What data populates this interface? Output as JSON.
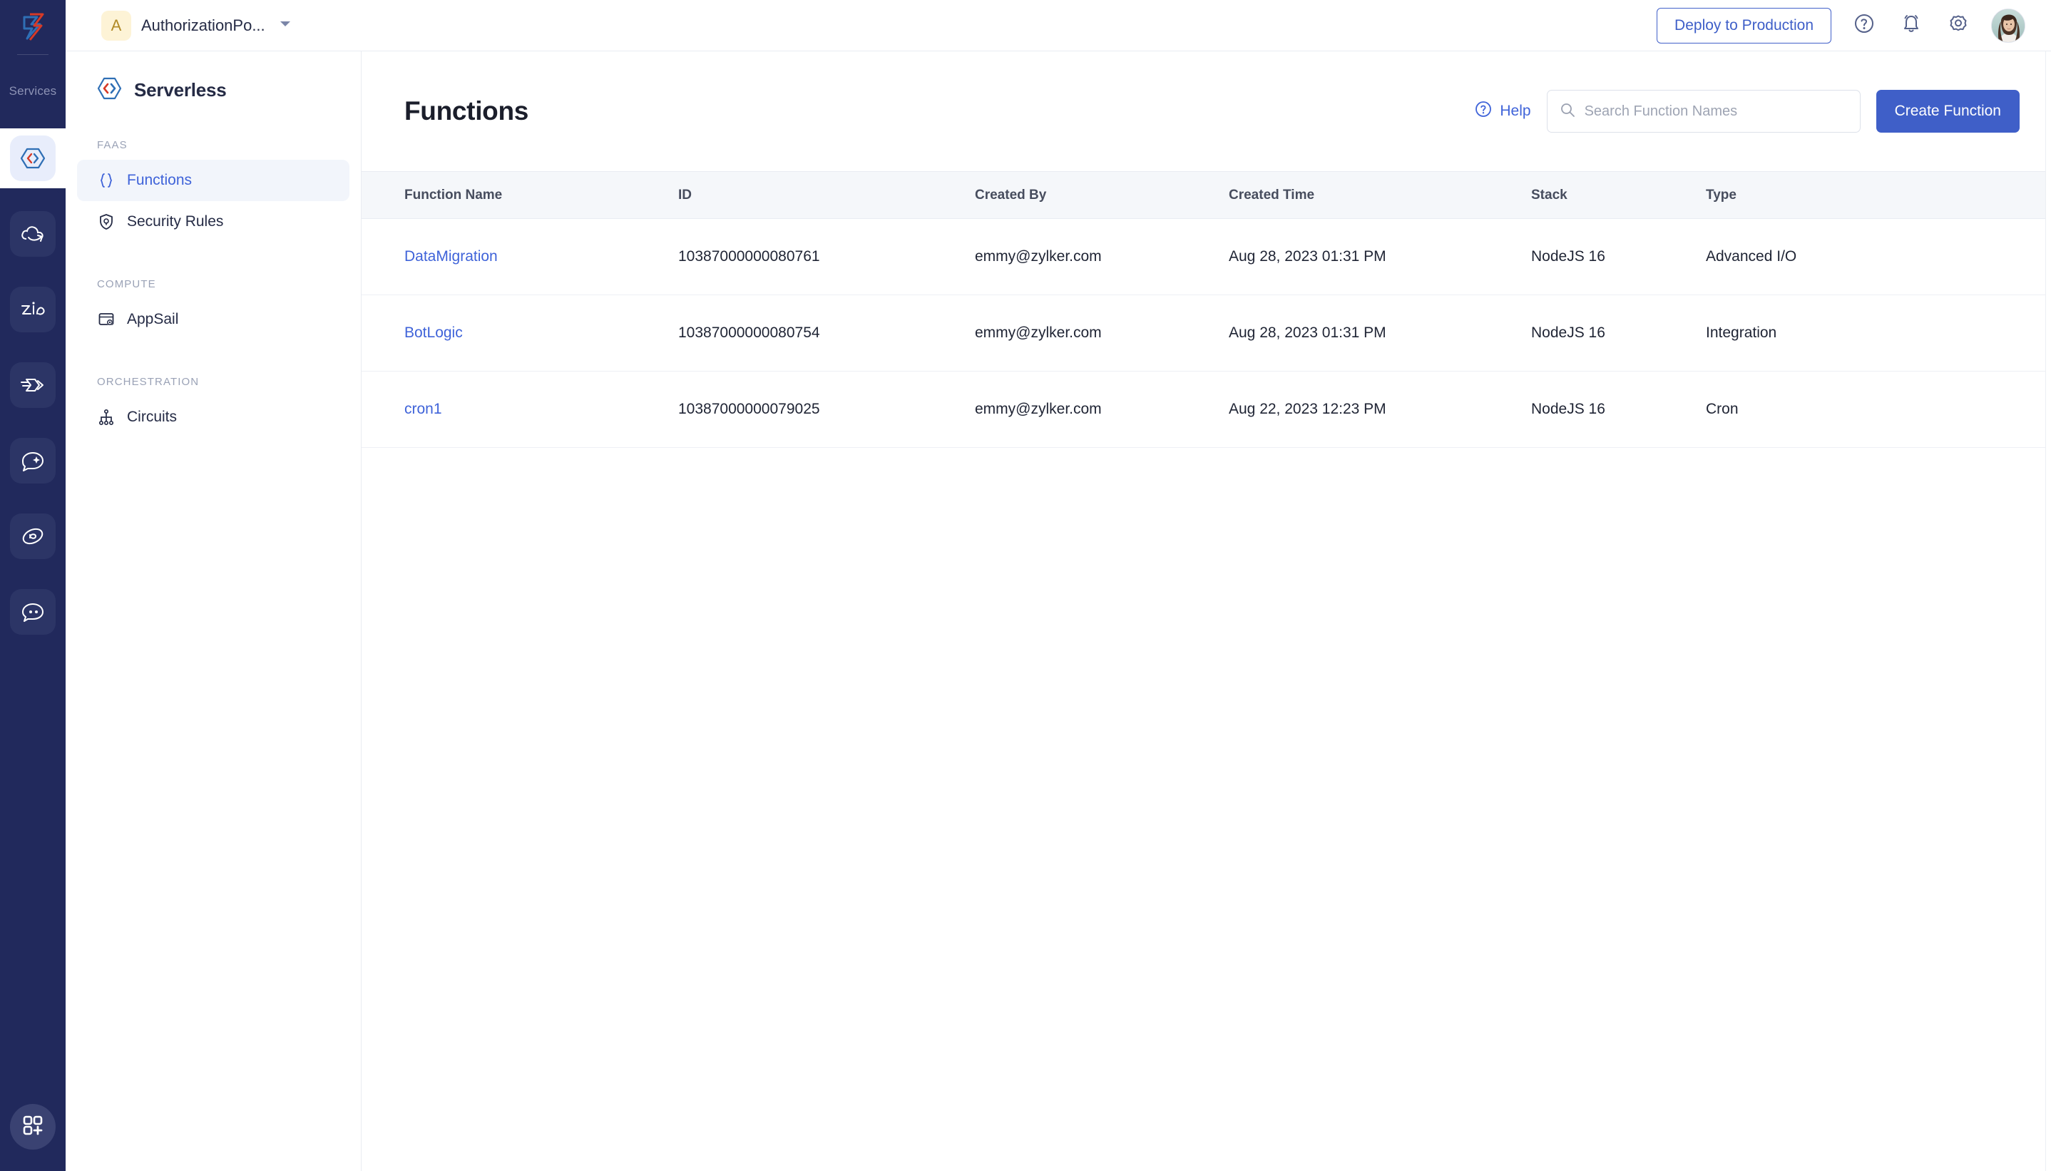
{
  "rail": {
    "logo_name": "zoho-catalyst-logo",
    "services_label": "Services",
    "items": [
      {
        "name": "serverless",
        "icon": "code-brackets-icon",
        "active": true
      },
      {
        "name": "cloud-scale",
        "icon": "cloud-arrow-icon",
        "active": false
      },
      {
        "name": "zia",
        "icon": "zia-icon",
        "active": false
      },
      {
        "name": "datastore",
        "icon": "layers-arrow-icon",
        "active": false
      },
      {
        "name": "smart-browz",
        "icon": "chat-sparkle-icon",
        "active": false
      },
      {
        "name": "signals",
        "icon": "swirl-icon",
        "active": false
      },
      {
        "name": "quick-ml",
        "icon": "chat-dots-icon",
        "active": false
      }
    ],
    "add_app_icon": "grid-plus-icon"
  },
  "topbar": {
    "org_initial": "A",
    "org_name": "AuthorizationPo...",
    "caret_icon": "chevron-down-icon",
    "deploy_label": "Deploy to Production",
    "help_icon": "question-circle-icon",
    "notification_icon": "bell-icon",
    "settings_icon": "gear-icon",
    "avatar_name": "user-avatar"
  },
  "sidebar": {
    "brand": "Serverless",
    "brand_icon": "serverless-logo-icon",
    "groups": [
      {
        "label": "FAAS",
        "items": [
          {
            "label": "Functions",
            "icon": "curly-braces-icon",
            "active": true
          },
          {
            "label": "Security Rules",
            "icon": "shield-lock-icon",
            "active": false
          }
        ]
      },
      {
        "label": "COMPUTE",
        "items": [
          {
            "label": "AppSail",
            "icon": "window-gear-icon",
            "active": false
          }
        ]
      },
      {
        "label": "ORCHESTRATION",
        "items": [
          {
            "label": "Circuits",
            "icon": "sitemap-icon",
            "active": false
          }
        ]
      }
    ]
  },
  "main": {
    "title": "Functions",
    "help_label": "Help",
    "help_icon": "question-circle-icon",
    "search": {
      "icon": "search-icon",
      "placeholder": "Search Function Names",
      "value": ""
    },
    "create_label": "Create Function",
    "table": {
      "columns": [
        "Function Name",
        "ID",
        "Created By",
        "Created Time",
        "Stack",
        "Type"
      ],
      "rows": [
        {
          "name": "DataMigration",
          "id": "10387000000080761",
          "created_by": "emmy@zylker.com",
          "created_time": "Aug 28, 2023 01:31 PM",
          "stack": "NodeJS 16",
          "type": "Advanced I/O"
        },
        {
          "name": "BotLogic",
          "id": "10387000000080754",
          "created_by": "emmy@zylker.com",
          "created_time": "Aug 28, 2023 01:31 PM",
          "stack": "NodeJS 16",
          "type": "Integration"
        },
        {
          "name": "cron1",
          "id": "10387000000079025",
          "created_by": "emmy@zylker.com",
          "created_time": "Aug 22, 2023 12:23 PM",
          "stack": "NodeJS 16",
          "type": "Cron"
        }
      ]
    }
  },
  "colors": {
    "rail_bg": "#21295c",
    "accent_blue": "#3f5fc8",
    "link_blue": "#3f63d9",
    "brand_dark": "#252b45",
    "brand_red": "#d63a27",
    "table_header_bg": "#f5f7fa",
    "org_avatar_bg": "#fdf3d6",
    "org_avatar_fg": "#b08a26"
  }
}
